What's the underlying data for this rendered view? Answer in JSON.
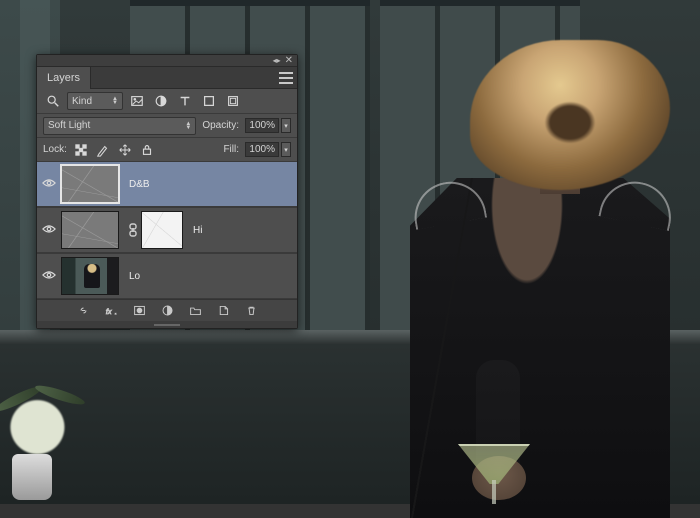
{
  "panel": {
    "title": "Layers",
    "filter_select": "Kind",
    "blend_mode": "Soft Light",
    "opacity_label": "Opacity:",
    "opacity_value": "100%",
    "lock_label": "Lock:",
    "fill_label": "Fill:",
    "fill_value": "100%",
    "layers": [
      {
        "name": "D&B"
      },
      {
        "name": "Hi"
      },
      {
        "name": "Lo"
      }
    ]
  }
}
